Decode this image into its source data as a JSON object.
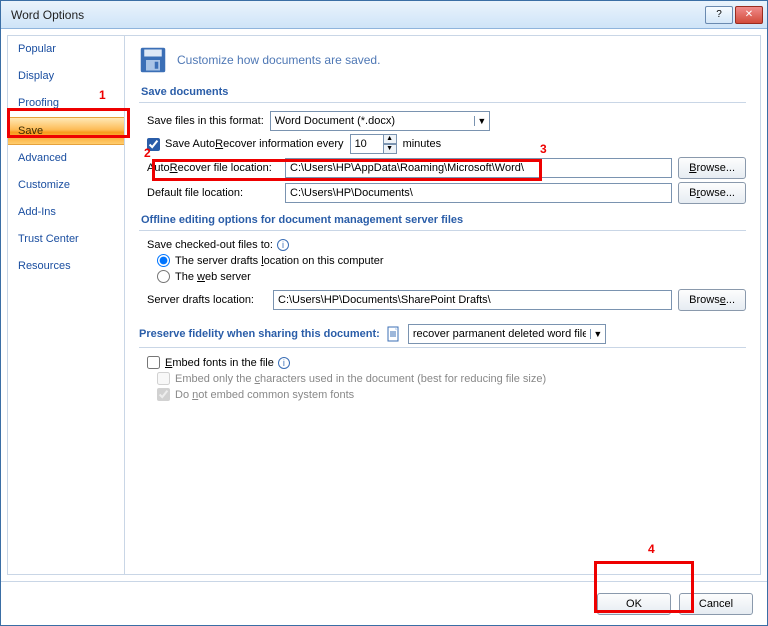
{
  "window": {
    "title": "Word Options"
  },
  "winbtns": {
    "help": "?",
    "close": "✕"
  },
  "sidebar": {
    "items": [
      {
        "label": "Popular"
      },
      {
        "label": "Display"
      },
      {
        "label": "Proofing"
      },
      {
        "label": "Save",
        "selected": true
      },
      {
        "label": "Advanced"
      },
      {
        "label": "Customize"
      },
      {
        "label": "Add-Ins"
      },
      {
        "label": "Trust Center"
      },
      {
        "label": "Resources"
      }
    ]
  },
  "header": "Customize how documents are saved.",
  "sections": {
    "save_documents": "Save documents",
    "offline": "Offline editing options for document management server files",
    "preserve": "Preserve fidelity when sharing this document:"
  },
  "save": {
    "format_label": "Save files in this format:",
    "format_value": "Word Document (*.docx)",
    "autorecover_chk": "Save AutoRecover information every",
    "autorecover_min": "10",
    "minutes": "minutes",
    "ar_loc_label": "AutoRecover file location:",
    "ar_loc_value": "C:\\Users\\HP\\AppData\\Roaming\\Microsoft\\Word\\",
    "def_loc_label": "Default file location:",
    "def_loc_value": "C:\\Users\\HP\\Documents\\",
    "browse": "Browse..."
  },
  "offline": {
    "chkout_label": "Save checked-out files to:",
    "opt_local": "The server drafts location on this computer",
    "opt_web": "The web server",
    "drafts_label": "Server drafts location:",
    "drafts_value": "C:\\Users\\HP\\Documents\\SharePoint Drafts\\",
    "browse": "Browse..."
  },
  "preserve": {
    "doc_name": "recover parmanent deleted word file",
    "embed": "Embed fonts in the file",
    "only_chars": "Embed only the characters used in the document (best for reducing file size)",
    "no_common": "Do not embed common system fonts"
  },
  "footer": {
    "ok": "OK",
    "cancel": "Cancel"
  },
  "annotations": {
    "n1": "1",
    "n2": "2",
    "n3": "3",
    "n4": "4"
  }
}
